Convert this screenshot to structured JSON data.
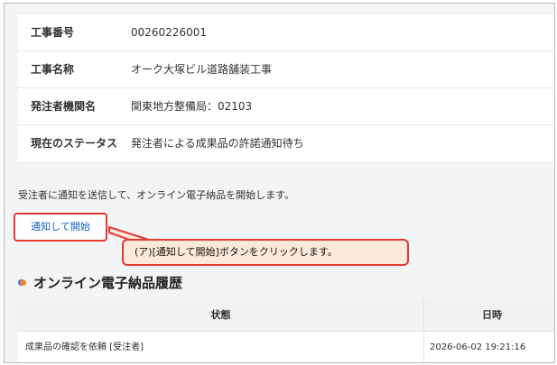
{
  "info": [
    {
      "label": "工事番号",
      "value": "00260226001"
    },
    {
      "label": "工事名称",
      "value": "オーク大塚ビル道路舗装工事"
    },
    {
      "label": "発注者機関名",
      "value": "関東地方整備局：02103"
    },
    {
      "label": "現在のステータス",
      "value": "発注者による成果品の許諾通知待ち"
    }
  ],
  "description": "受注者に通知を送信して、オンライン電子納品を開始します。",
  "start_button_label": "通知して開始",
  "callout_text": "(ア)[通知して開始]ボタンをクリックします。",
  "history": {
    "heading": "オンライン電子納品履歴",
    "columns": [
      "状態",
      "日時"
    ],
    "rows": [
      {
        "status": "成果品の確認を依頼 [受注者]",
        "datetime": "2026-06-02 19:21:16"
      }
    ]
  },
  "colors": {
    "highlight": "#e53935",
    "link": "#1565c0",
    "callout_bg": "#fde9d9"
  }
}
